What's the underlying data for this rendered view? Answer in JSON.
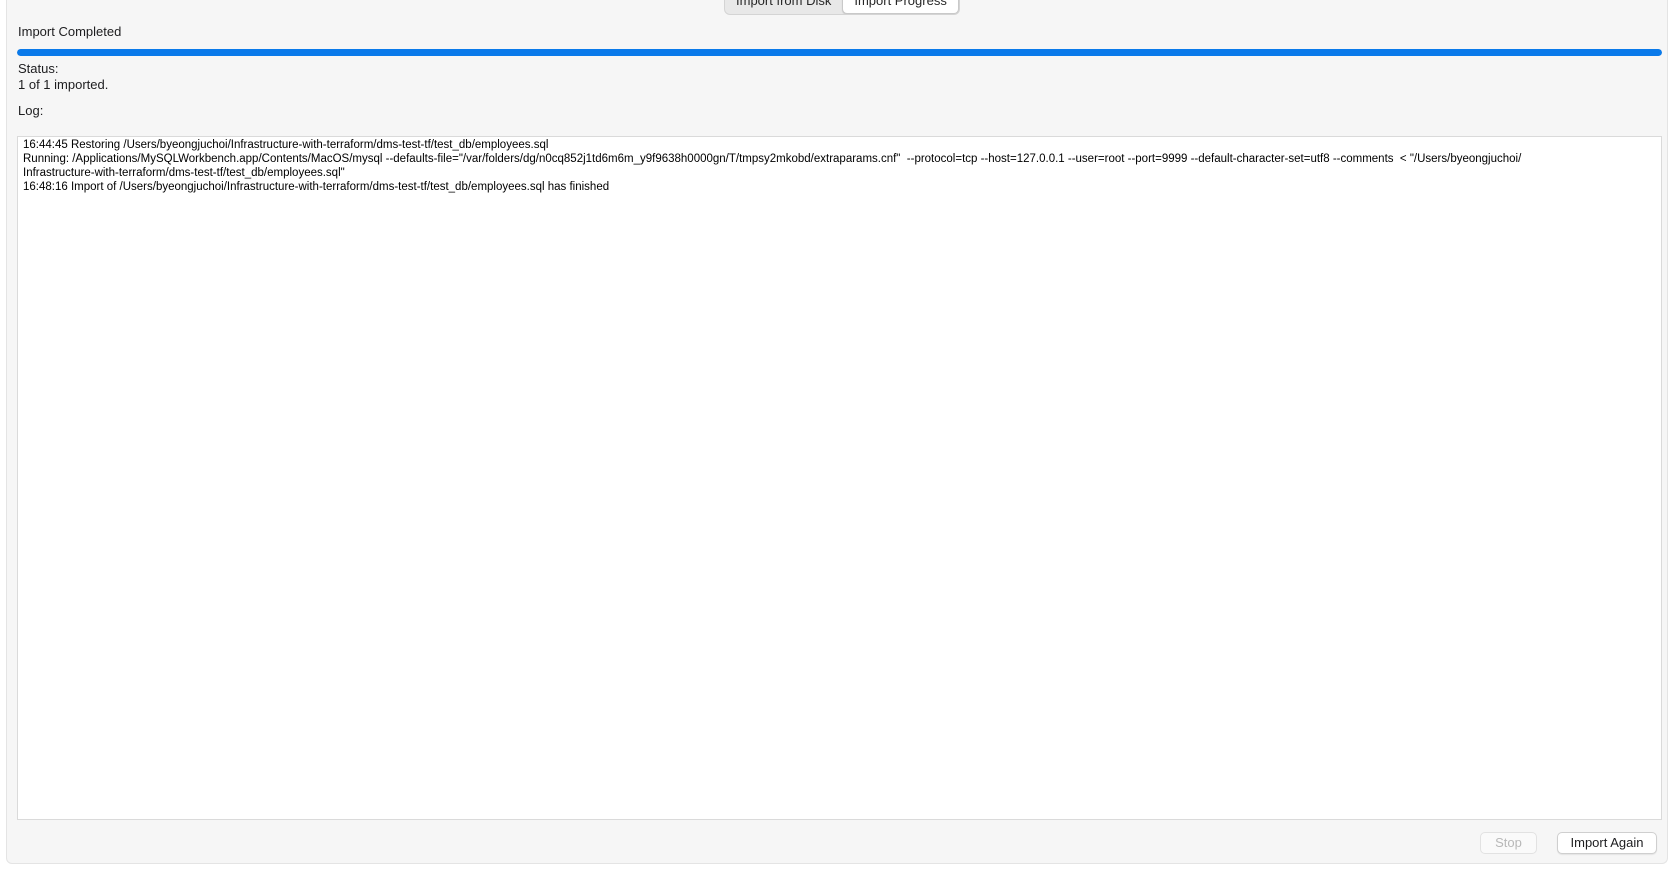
{
  "tabs": [
    {
      "label": "Import from Disk",
      "active": false
    },
    {
      "label": "Import Progress",
      "active": true
    }
  ],
  "progress": {
    "title": "Import Completed",
    "fraction": 1.0,
    "color": "#0a7aea"
  },
  "status": {
    "label": "Status:",
    "value": "1 of 1 imported."
  },
  "log": {
    "label": "Log:",
    "lines": [
      "16:44:45 Restoring /Users/byeongjuchoi/Infrastructure-with-terraform/dms-test-tf/test_db/employees.sql",
      "Running: /Applications/MySQLWorkbench.app/Contents/MacOS/mysql --defaults-file=\"/var/folders/dg/n0cq852j1td6m6m_y9f9638h0000gn/T/tmpsy2mkobd/extraparams.cnf\"  --protocol=tcp --host=127.0.0.1 --user=root --port=9999 --default-character-set=utf8 --comments  < \"/Users/byeongjuchoi/\nInfrastructure-with-terraform/dms-test-tf/test_db/employees.sql\"",
      "16:48:16 Import of /Users/byeongjuchoi/Infrastructure-with-terraform/dms-test-tf/test_db/employees.sql has finished"
    ]
  },
  "buttons": {
    "stop_label": "Stop",
    "stop_enabled": false,
    "import_again_label": "Import Again"
  }
}
